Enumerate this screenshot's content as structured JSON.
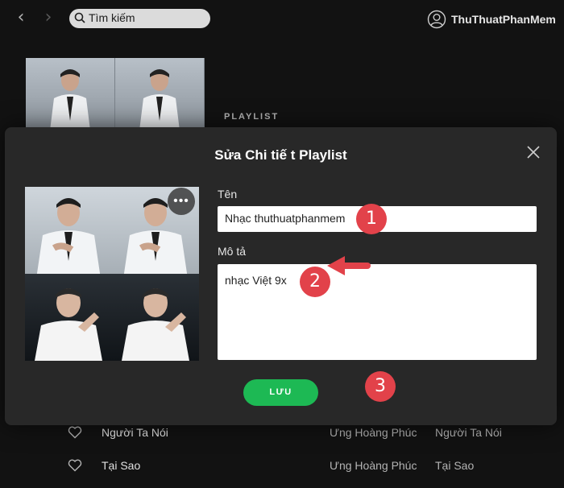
{
  "topbar": {
    "search_placeholder": "Tìm kiếm",
    "user_name": "ThuThuatPhanMem"
  },
  "playlist": {
    "type_label": "PLAYLIST"
  },
  "tracks": [
    {
      "title": "Người Ta Nói",
      "artist": "Ưng Hoàng Phúc",
      "album": "Người Ta Nói"
    },
    {
      "title": "Tại Sao",
      "artist": "Ưng Hoàng Phúc",
      "album": "Tại Sao"
    }
  ],
  "modal": {
    "title": "Sửa Chi tiế t Playlist",
    "name_label": "Tên",
    "name_value": "Nhạc thuthuatphanmem",
    "desc_label": "Mô tả",
    "desc_value": "nhạc Việt 9x",
    "more_label": "•••",
    "save_label": "LƯU"
  },
  "annotations": {
    "step1": "1",
    "step2": "2",
    "step3": "3",
    "color": "#e2424a"
  },
  "colors": {
    "background": "#121212",
    "modal": "#282828",
    "save_button": "#1db954"
  },
  "icons": [
    "back-arrow-icon",
    "forward-arrow-icon",
    "search-icon",
    "user-icon",
    "close-icon",
    "heart-icon",
    "more-icon"
  ]
}
